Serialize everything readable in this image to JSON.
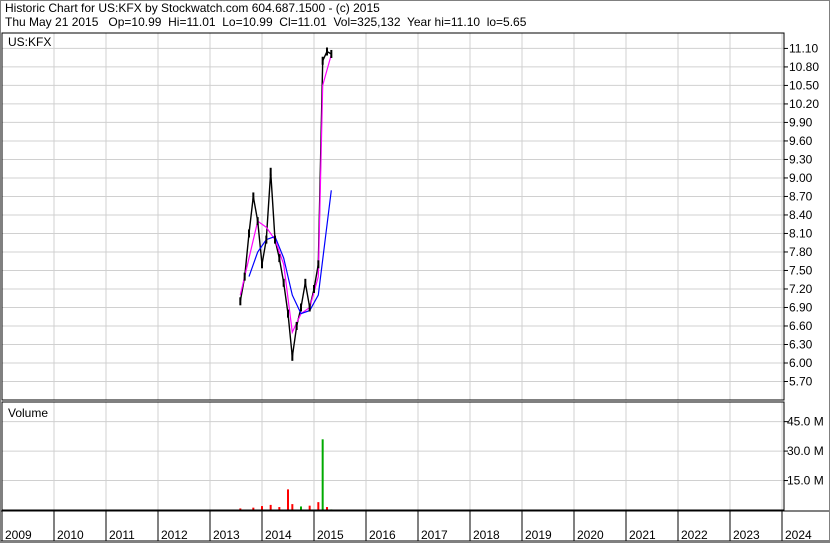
{
  "header": {
    "line1": "Historic Chart for US:KFX by Stockwatch.com 604.687.1500 - (c) 2015",
    "line2": "Thu May 21 2015   Op=10.99  Hi=11.01  Lo=10.99  Cl=11.01  Vol=325,132  Year hi=11.10  lo=5.65"
  },
  "price_panel": {
    "label": "US:KFX"
  },
  "volume_panel": {
    "label": "Volume"
  },
  "colors": {
    "price_bar": "#000000",
    "ma_short": "#ff00ff",
    "ma_long": "#0000ff",
    "vol_up": "#00aa00",
    "vol_down": "#ff0000",
    "grid": "#d0d0d0"
  },
  "chart_data": [
    {
      "type": "line",
      "title": "US:KFX",
      "x_ticks": [
        "2009",
        "2010",
        "2011",
        "2012",
        "2013",
        "2014",
        "2015",
        "2016",
        "2017",
        "2018",
        "2019",
        "2020",
        "2021",
        "2022",
        "2023",
        "2024"
      ],
      "y_ticks": [
        "11.10",
        "10.80",
        "10.50",
        "10.20",
        "9.90",
        "9.60",
        "9.30",
        "9.00",
        "8.70",
        "8.40",
        "8.10",
        "7.80",
        "7.50",
        "7.20",
        "6.90",
        "6.60",
        "6.30",
        "6.00",
        "5.70"
      ],
      "ylim": [
        5.4,
        11.35
      ],
      "grid": true,
      "series": [
        {
          "x": [
            "2013-08",
            "2013-09",
            "2013-10",
            "2013-11",
            "2013-12",
            "2014-01",
            "2014-02",
            "2014-03",
            "2014-04",
            "2014-05",
            "2014-06",
            "2014-07",
            "2014-08",
            "2014-09",
            "2014-10",
            "2014-11",
            "2014-12",
            "2015-01",
            "2015-02",
            "2015-03",
            "2015-04",
            "2015-05"
          ],
          "values": [
            7.0,
            7.4,
            8.1,
            8.7,
            8.3,
            7.6,
            8.0,
            9.1,
            8.0,
            7.7,
            7.3,
            6.8,
            6.1,
            6.6,
            6.9,
            7.3,
            6.9,
            7.2,
            7.6,
            10.9,
            11.05,
            11.01
          ]
        },
        {
          "x": [
            "2013-08",
            "2013-10",
            "2013-12",
            "2014-02",
            "2014-04",
            "2014-06",
            "2014-08",
            "2014-10",
            "2014-12",
            "2015-02",
            "2015-03",
            "2015-05"
          ],
          "values": [
            7.1,
            7.7,
            8.3,
            8.2,
            8.0,
            7.6,
            6.5,
            6.8,
            6.9,
            7.4,
            10.5,
            11.0
          ]
        },
        {
          "x": [
            "2013-10",
            "2013-12",
            "2014-02",
            "2014-04",
            "2014-06",
            "2014-08",
            "2014-10",
            "2014-12",
            "2015-02",
            "2015-05"
          ],
          "values": [
            7.4,
            7.8,
            8.0,
            8.05,
            7.7,
            7.1,
            6.8,
            6.85,
            7.1,
            8.8
          ]
        }
      ]
    },
    {
      "type": "bar",
      "title": "Volume",
      "y_ticks": [
        "45.0 M",
        "30.0 M",
        "15.0 M"
      ],
      "ylim": [
        0,
        55
      ],
      "grid": true,
      "x": [
        "2013-08",
        "2013-11",
        "2014-01",
        "2014-03",
        "2014-05",
        "2014-07",
        "2014-08",
        "2014-10",
        "2014-12",
        "2015-02",
        "2015-03",
        "2015-04",
        "2015-05"
      ],
      "values": [
        0.8,
        1.2,
        2.0,
        2.6,
        1.5,
        10.5,
        3.0,
        1.8,
        2.2,
        4.0,
        36.0,
        1.5,
        0.3
      ],
      "direction": [
        "down",
        "down",
        "down",
        "down",
        "down",
        "down",
        "down",
        "up",
        "down",
        "down",
        "up",
        "down",
        "up"
      ]
    }
  ]
}
